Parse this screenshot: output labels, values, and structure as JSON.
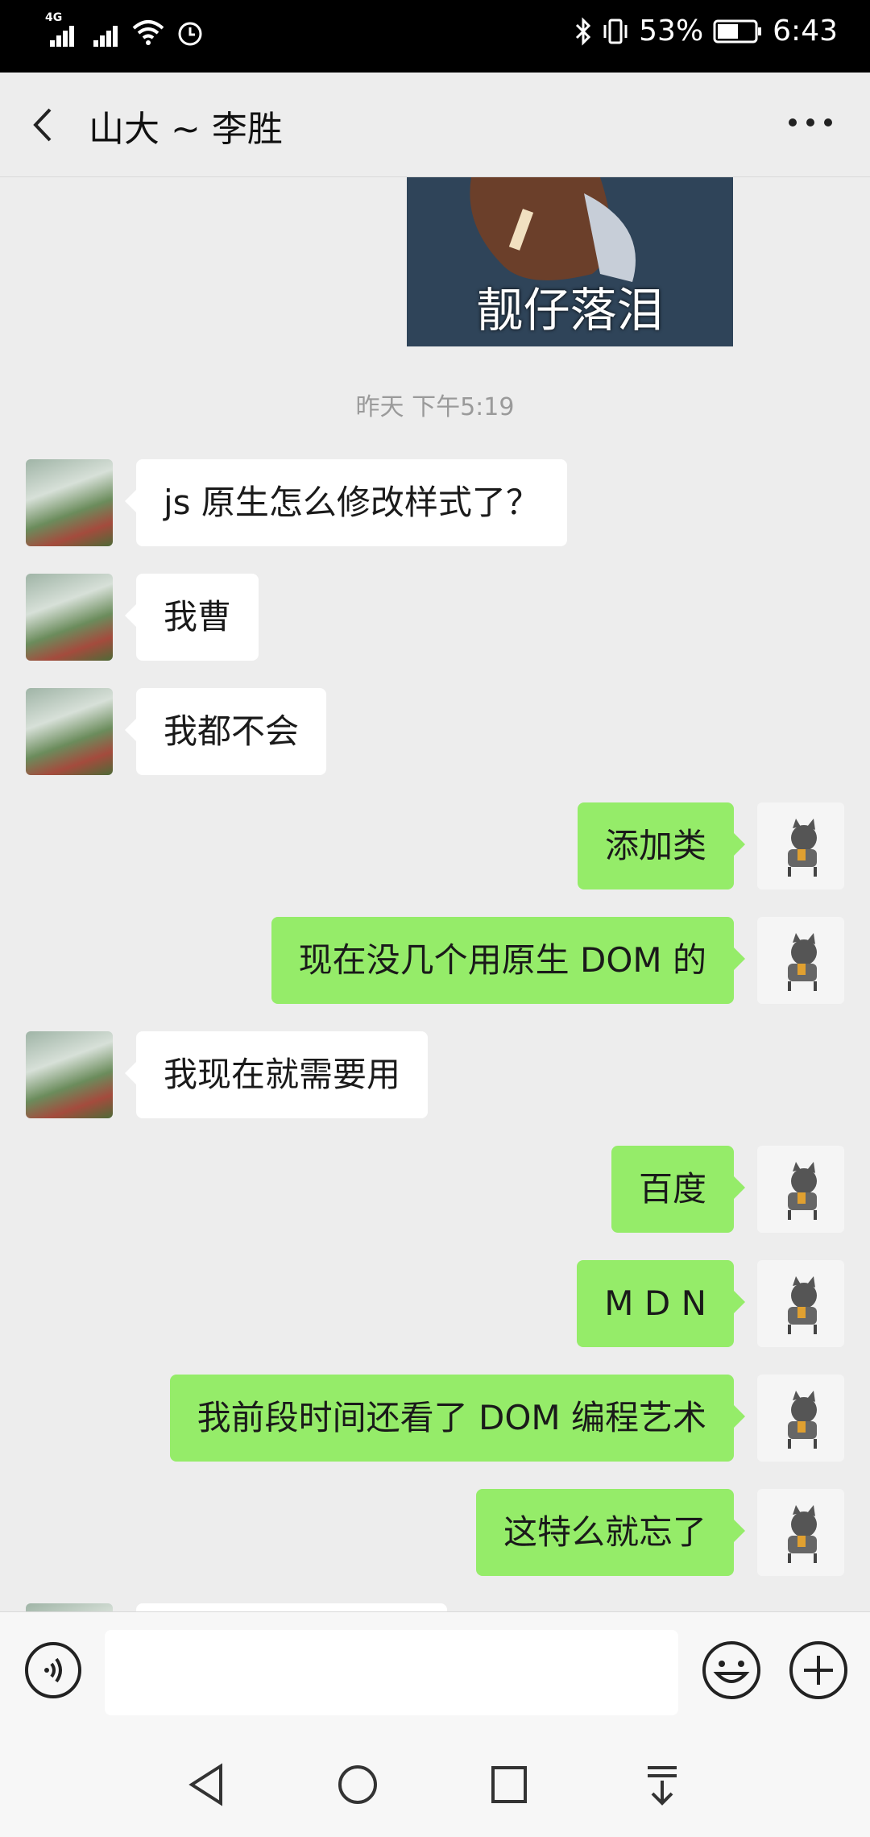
{
  "status": {
    "network": "4G",
    "battery": "53%",
    "time": "6:43"
  },
  "header": {
    "title": "山大 ~ 李胜"
  },
  "chat": {
    "image_caption": "靓仔落泪",
    "timestamp": "昨天 下午5:19",
    "messages": [
      {
        "side": "left",
        "text": "js 原生怎么修改样式了？"
      },
      {
        "side": "left",
        "text": "我曹"
      },
      {
        "side": "left",
        "text": "我都不会"
      },
      {
        "side": "right",
        "text": "添加类"
      },
      {
        "side": "right",
        "text": "现在没几个用原生 DOM 的"
      },
      {
        "side": "left",
        "text": "我现在就需要用"
      },
      {
        "side": "right",
        "text": "百度"
      },
      {
        "side": "right",
        "text": "M D N"
      },
      {
        "side": "right",
        "text": "我前段时间还看了 DOM 编程艺术"
      },
      {
        "side": "right",
        "text": "这特么就忘了"
      }
    ]
  },
  "colors": {
    "outgoing_bubble": "#95ec69",
    "incoming_bubble": "#ffffff",
    "background": "#ededed"
  },
  "icons": [
    "back-icon",
    "more-icon",
    "voice-icon",
    "emoji-icon",
    "plus-icon",
    "nav-back-icon",
    "nav-home-icon",
    "nav-recents-icon",
    "nav-notification-icon"
  ]
}
